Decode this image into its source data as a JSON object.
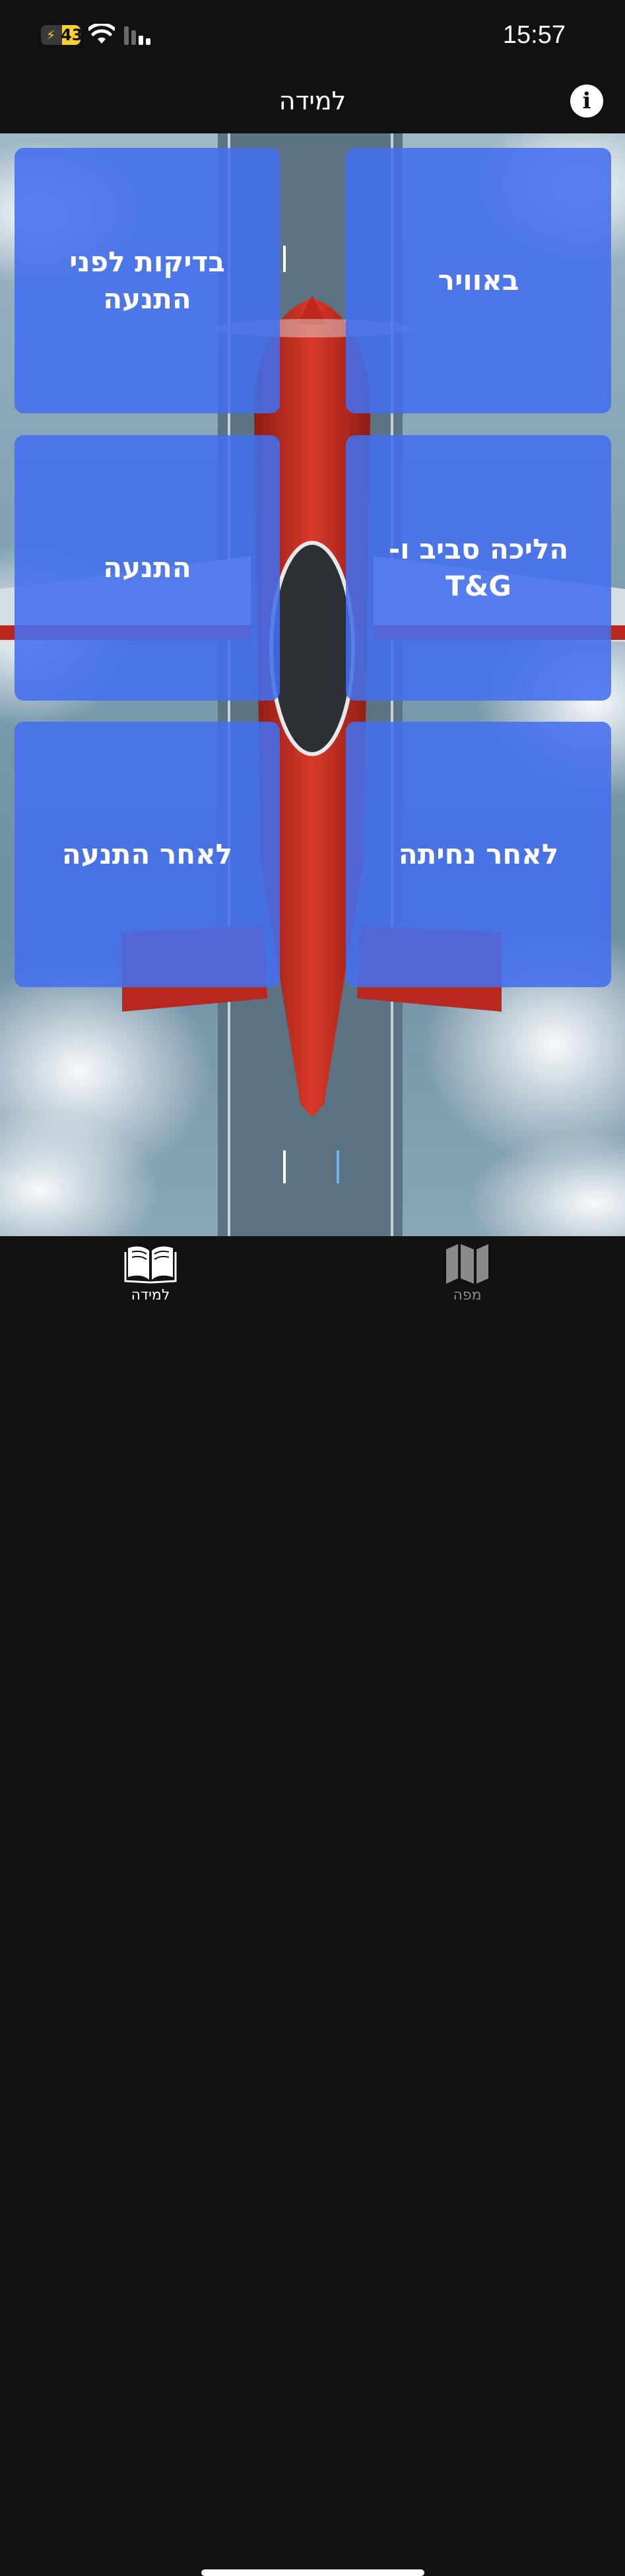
{
  "status_bar": {
    "battery_level": "43",
    "battery_icon": "battery-charging-icon",
    "wifi_icon": "wifi-icon",
    "signal_icon": "cellular-signal-icon",
    "time": "15:57"
  },
  "nav": {
    "title": "למידה",
    "info_icon": "info-icon"
  },
  "tiles": [
    {
      "label": "באוויר"
    },
    {
      "label": "בדיקות לפני התנעה"
    },
    {
      "label": "הליכה סביב ו-T&G"
    },
    {
      "label": "התנעה"
    },
    {
      "label": "לאחר נחיתה"
    },
    {
      "label": "לאחר התנעה"
    }
  ],
  "tab_bar": {
    "tabs": [
      {
        "label": "למידה",
        "icon": "open-book-icon",
        "selected": true
      },
      {
        "label": "מפה",
        "icon": "map-icon",
        "selected": false
      }
    ]
  },
  "colors": {
    "bar_background": "#111111",
    "tile_blue": "#436EEE",
    "selected_tab": "#FFFFFF",
    "unselected_tab": "#8A8A8A",
    "battery_yellow": "#F7D22E"
  }
}
